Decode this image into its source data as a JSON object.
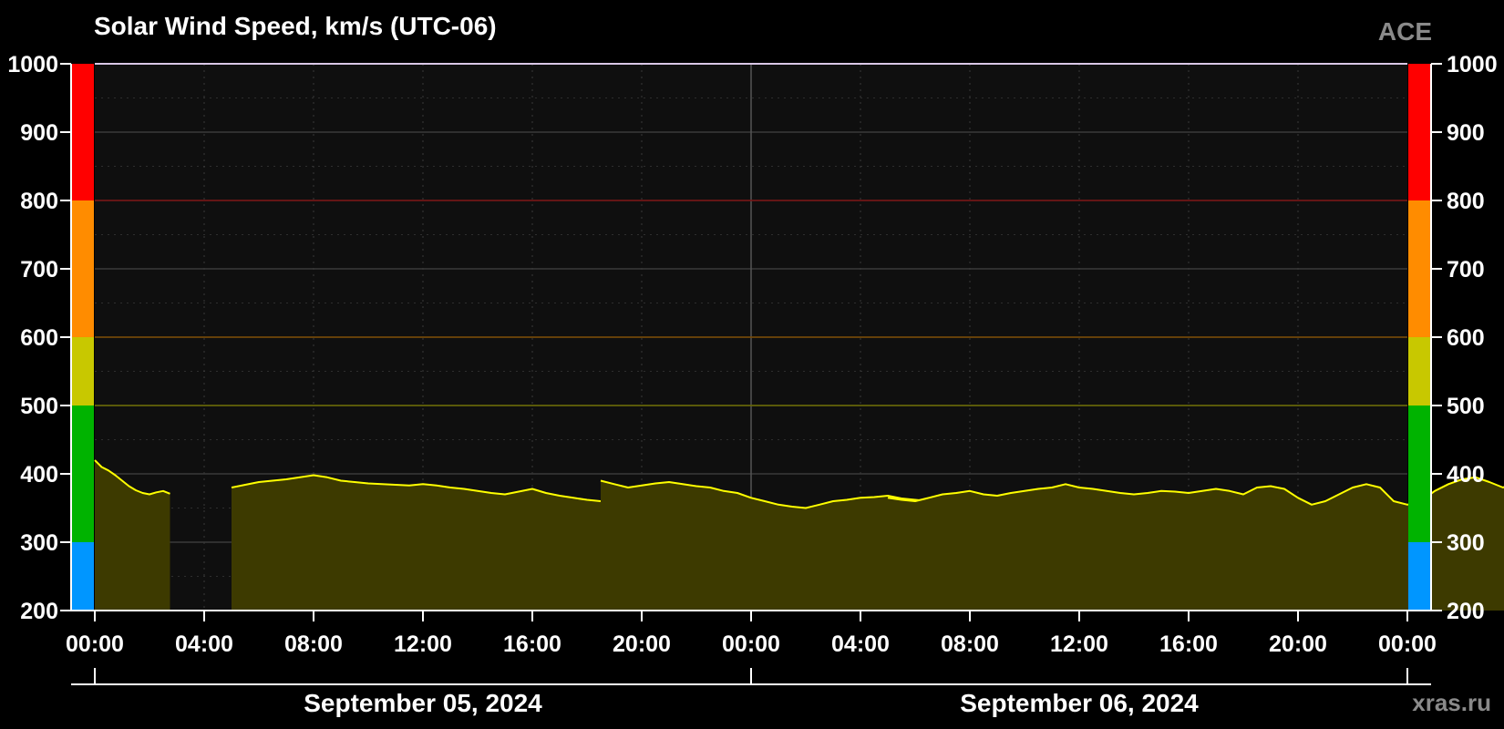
{
  "chart_data": {
    "type": "area",
    "title": "Solar Wind Speed, km/s (UTC-06)",
    "source": "ACE",
    "credit": "xras.ru",
    "ylim": [
      200,
      1000
    ],
    "y_ticks": [
      200,
      300,
      400,
      500,
      600,
      700,
      800,
      900,
      1000
    ],
    "x_range_hours": [
      0,
      48
    ],
    "x_tick_labels": [
      "00:00",
      "04:00",
      "08:00",
      "12:00",
      "16:00",
      "20:00",
      "00:00",
      "04:00",
      "08:00",
      "12:00",
      "16:00",
      "20:00",
      "00:00"
    ],
    "date_labels": [
      "September 05, 2024",
      "September 06, 2024"
    ],
    "grid": true,
    "colors": {
      "background": "#000000",
      "plot_background": "#0f0f0f",
      "line": "#ffff00",
      "fill": "#3d3a00",
      "grid": "#3a3a3a",
      "scale_bands": [
        {
          "from": 200,
          "to": 300,
          "color": "#0096ff"
        },
        {
          "from": 300,
          "to": 500,
          "color": "#00b300"
        },
        {
          "from": 500,
          "to": 600,
          "color": "#c8c800"
        },
        {
          "from": 600,
          "to": 800,
          "color": "#ff8c00"
        },
        {
          "from": 800,
          "to": 1000,
          "color": "#ff0000"
        }
      ],
      "threshold_lines": [
        {
          "value": 500,
          "color": "#6b6b00"
        },
        {
          "value": 600,
          "color": "#7a4a00"
        },
        {
          "value": 800,
          "color": "#7a1010"
        }
      ]
    },
    "series": [
      {
        "segments": [
          {
            "start": 0.0,
            "step": 0.25,
            "values": [
              420,
              410,
              405,
              398,
              390,
              382,
              376,
              372,
              370,
              373,
              375,
              371
            ]
          },
          {
            "start": 5.0,
            "step": 0.5,
            "values": [
              380,
              384,
              388,
              390,
              392,
              395,
              398,
              395,
              390,
              388,
              386,
              385,
              384,
              383,
              385,
              383,
              380,
              378,
              375,
              372,
              370,
              374,
              378,
              372,
              368,
              365,
              362,
              360
            ]
          },
          {
            "start": 18.5,
            "step": 0.5,
            "values": [
              390,
              385,
              380,
              383,
              386,
              388,
              385,
              382,
              380,
              375,
              372,
              365,
              360,
              355,
              352,
              350,
              355,
              360,
              362,
              365,
              366,
              368,
              364,
              362,
              360,
              362
            ]
          },
          {
            "start": 29.0,
            "step": 0.5,
            "values": [
              365,
              362,
              360,
              365,
              370,
              372,
              375,
              370,
              368,
              372,
              375,
              378,
              380,
              385,
              380,
              378,
              375,
              372,
              370,
              372,
              375,
              374,
              372,
              375,
              378,
              375,
              370,
              380,
              382,
              378,
              365,
              355,
              360,
              370,
              380,
              385,
              380,
              360,
              355,
              360,
              375,
              385,
              392,
              395,
              388,
              380,
              390,
              400
            ]
          }
        ]
      }
    ]
  }
}
